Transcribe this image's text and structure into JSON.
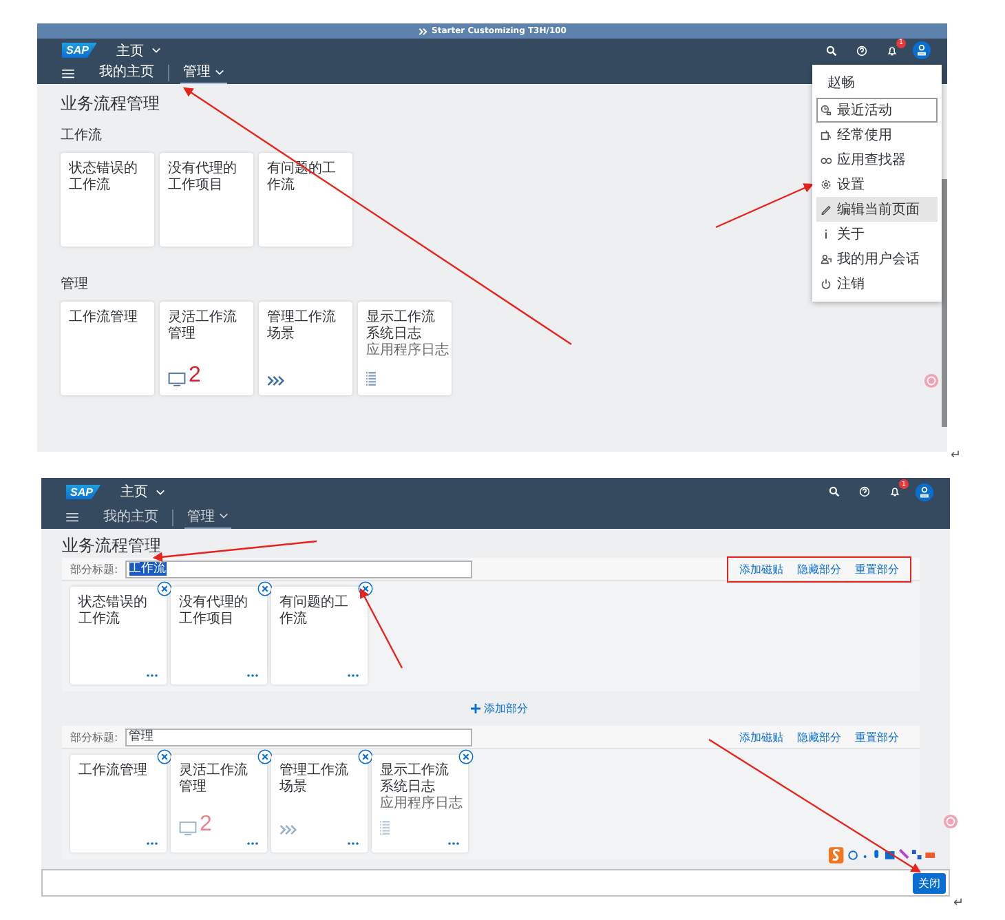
{
  "view_screen": {
    "title_bar": "Starter Customizing  T3H/100",
    "shell": {
      "logo": "SAP",
      "home": "主页",
      "notification_count": "1",
      "nav": [
        {
          "label": "我的主页",
          "selected": false
        },
        {
          "label": "管理",
          "selected": true
        }
      ]
    },
    "page_title": "业务流程管理",
    "groups": [
      {
        "title": "工作流",
        "tiles": [
          {
            "kind": "plain",
            "title": "状态错误的工作流"
          },
          {
            "kind": "plain",
            "title": "没有代理的工作项目"
          },
          {
            "kind": "plain",
            "title": "有问题的工作流"
          }
        ]
      },
      {
        "title": "管理",
        "tiles": [
          {
            "kind": "plain",
            "title": "工作流管理"
          },
          {
            "kind": "count",
            "title": "灵活工作流管理",
            "number": "2"
          },
          {
            "kind": "chevrons",
            "title": "管理工作流场景"
          },
          {
            "kind": "log",
            "title": "显示工作流系统日志",
            "subtitle": "应用程序日志"
          }
        ]
      }
    ],
    "user_menu": {
      "name": "赵畅",
      "items": [
        {
          "kind": "recent",
          "label": "最近活动",
          "focused": true,
          "selected": false
        },
        {
          "kind": "frequent",
          "label": "经常使用",
          "focused": false,
          "selected": false
        },
        {
          "kind": "finder",
          "label": "应用查找器",
          "focused": false,
          "selected": false
        },
        {
          "kind": "settings",
          "label": "设置",
          "focused": false,
          "selected": false
        },
        {
          "kind": "edit",
          "label": "编辑当前页面",
          "focused": false,
          "selected": true
        },
        {
          "kind": "about",
          "label": "关于",
          "focused": false,
          "selected": false
        },
        {
          "kind": "sessions",
          "label": "我的用户会话",
          "focused": false,
          "selected": false
        },
        {
          "kind": "logout",
          "label": "注销",
          "focused": false,
          "selected": false
        }
      ]
    },
    "paragraph_mark": "↵"
  },
  "edit_screen": {
    "shell": {
      "logo": "SAP",
      "home": "主页",
      "notification_count": "1",
      "nav": [
        {
          "label": "我的主页",
          "selected": false
        },
        {
          "label": "管理",
          "selected": true
        }
      ]
    },
    "page_title": "业务流程管理",
    "sections": [
      {
        "title_label": "部分标题:",
        "title_value": "工作流",
        "title_selected": true,
        "framed": true,
        "actions": [
          "添加磁贴",
          "隐藏部分",
          "重置部分"
        ],
        "tiles": [
          {
            "kind": "plain",
            "title": "状态错误的工作流"
          },
          {
            "kind": "plain",
            "title": "没有代理的工作项目"
          },
          {
            "kind": "plain",
            "title": "有问题的工作流"
          }
        ]
      },
      {
        "title_label": "部分标题:",
        "title_value": "管理",
        "title_selected": false,
        "framed": false,
        "actions": [
          "添加磁贴",
          "隐藏部分",
          "重置部分"
        ],
        "tiles": [
          {
            "kind": "plain",
            "title": "工作流管理"
          },
          {
            "kind": "count",
            "title": "灵活工作流管理",
            "number": "2"
          },
          {
            "kind": "chevrons",
            "title": "管理工作流场景"
          },
          {
            "kind": "log",
            "title": "显示工作流系统日志",
            "subtitle": "应用程序日志"
          }
        ]
      }
    ],
    "add_section": "添加部分",
    "close_button": "关闭",
    "paragraph_mark": "↵"
  }
}
